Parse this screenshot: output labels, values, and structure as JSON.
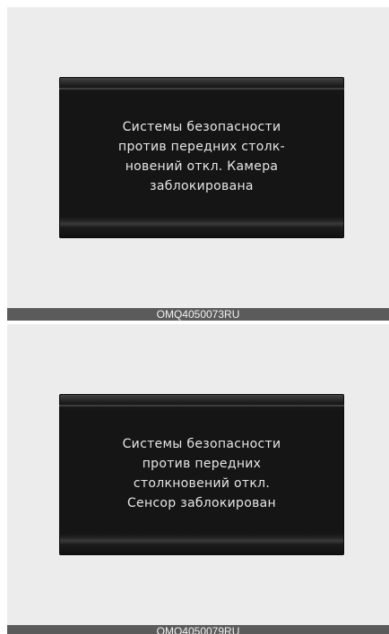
{
  "figures": [
    {
      "message_lines": [
        "Системы безопасности",
        "против передних столк-",
        "новений откл. Камера",
        "заблокирована"
      ],
      "caption": "OMQ4050073RU"
    },
    {
      "message_lines": [
        "Системы безопасности",
        "против передних",
        "столкновений откл.",
        "Сенсор заблокирован"
      ],
      "caption": "OMQ4050079RU"
    }
  ],
  "colors": {
    "page_background": "#ffffff",
    "panel_background": "#ececec",
    "screen_background": "#151515",
    "screen_text": "#e6e6e6",
    "caption_bar": "#5b5b5b",
    "caption_text": "#f2f2f2"
  }
}
